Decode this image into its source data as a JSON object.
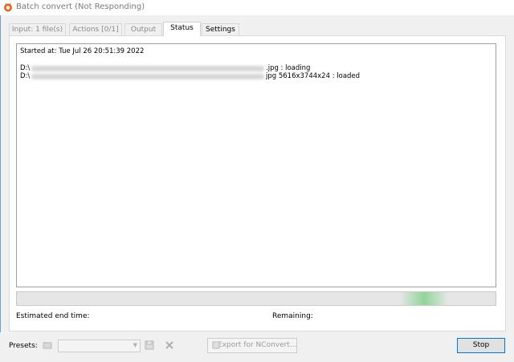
{
  "window": {
    "title": "Batch convert (Not Responding)"
  },
  "tabs": [
    {
      "label": "Input: 1 file(s)",
      "active": false,
      "enabled": false
    },
    {
      "label": "Actions [0/1]",
      "active": false,
      "enabled": false
    },
    {
      "label": "Output",
      "active": false,
      "enabled": false
    },
    {
      "label": "Status",
      "active": true,
      "enabled": true
    },
    {
      "label": "Settings",
      "active": false,
      "enabled": true
    }
  ],
  "status": {
    "started_at": "Started at: Tue Jul 26 20:51:39 2022",
    "log": [
      {
        "prefix": "D:\\",
        "suffix": ".jpg : loading"
      },
      {
        "prefix": "D:\\",
        "suffix": "jpg 5616x3744x24 : loaded"
      }
    ],
    "progress_percent": 85
  },
  "info": {
    "estimated_end_label": "Estimated end time:",
    "remaining_label": "Remaining:"
  },
  "footer": {
    "presets_label": "Presets:",
    "preset_value": "",
    "export_label": "Export for NConvert...",
    "stop_label": "Stop"
  },
  "colors": {
    "progress": "#8fd69a",
    "accent": "#0078d7",
    "icon": "#e8611a"
  }
}
